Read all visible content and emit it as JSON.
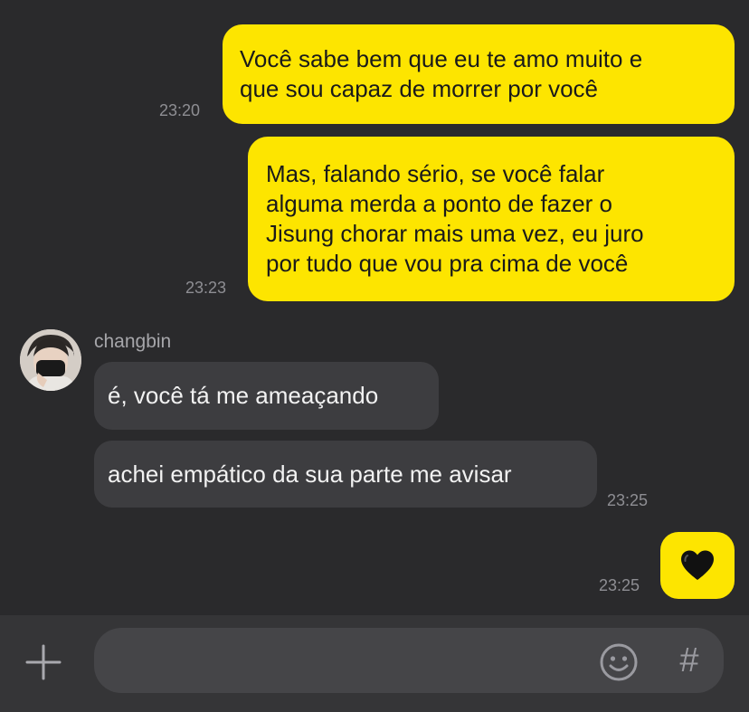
{
  "messages": [
    {
      "direction": "sent",
      "text": "Você sabe bem que eu te amo muito e\nque sou capaz de morrer por você",
      "time": "23:20"
    },
    {
      "direction": "sent",
      "text": "Mas, falando sério, se você falar\nalguma merda a ponto de fazer o\nJisung chorar mais uma vez, eu juro\npor tudo que vou pra cima de você",
      "time": "23:23"
    },
    {
      "direction": "received",
      "sender": "changbin",
      "text": "é, você tá me ameaçando"
    },
    {
      "direction": "received",
      "text": "achei empático da sua parte me avisar",
      "time": "23:25"
    },
    {
      "direction": "sent",
      "text": "🖤",
      "time": "23:25"
    }
  ],
  "composer": {
    "plus_icon": "plus-icon",
    "emoji_icon": "smiley-icon",
    "hash_label": "#"
  },
  "colors": {
    "background": "#2a2a2c",
    "sent_bubble": "#fde500",
    "received_bubble": "#3d3d40",
    "composer_bar": "#353537"
  }
}
